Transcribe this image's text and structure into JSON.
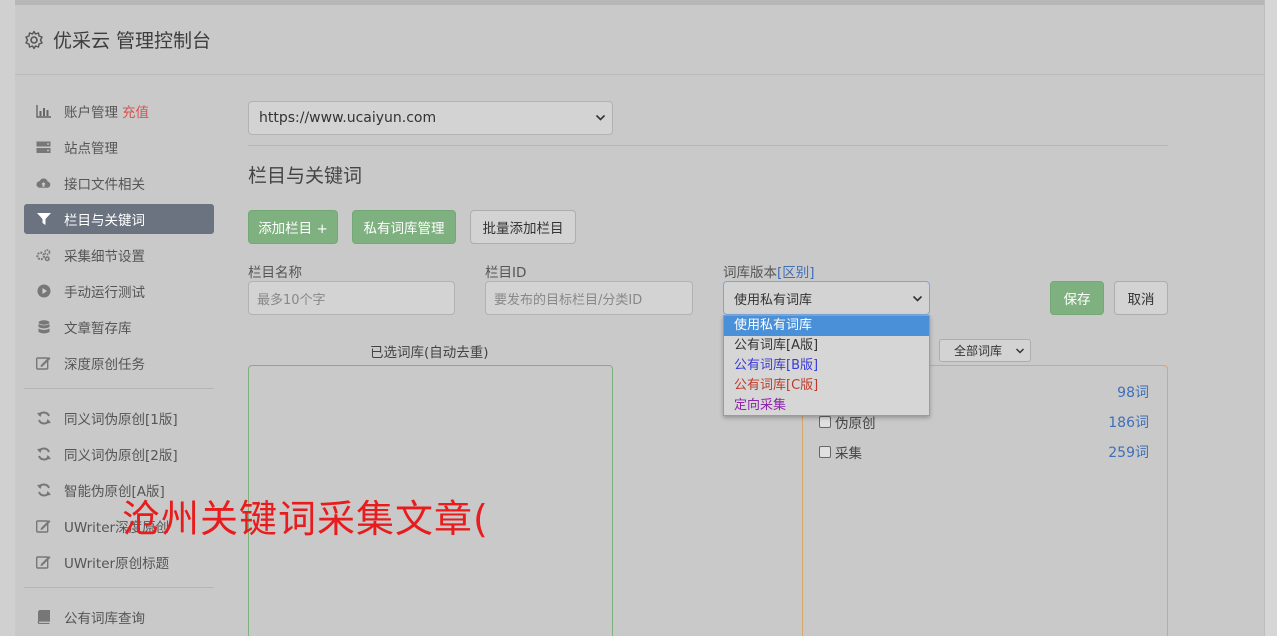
{
  "header": {
    "title": "优采云 管理控制台"
  },
  "sidebar": {
    "items": [
      {
        "label": "账户管理",
        "extra": "充值",
        "icon": "bar-chart-icon"
      },
      {
        "label": "站点管理",
        "icon": "server-icon"
      },
      {
        "label": "接口文件相关",
        "icon": "cloud-upload-icon"
      },
      {
        "label": "栏目与关键词",
        "icon": "filter-icon",
        "active": true
      },
      {
        "label": "采集细节设置",
        "icon": "cogs-icon"
      },
      {
        "label": "手动运行测试",
        "icon": "play-circle-icon"
      },
      {
        "label": "文章暂存库",
        "icon": "database-icon"
      },
      {
        "label": "深度原创任务",
        "icon": "edit-icon"
      }
    ],
    "items2": [
      {
        "label": "同义词伪原创[1版]",
        "icon": "refresh-icon"
      },
      {
        "label": "同义词伪原创[2版]",
        "icon": "refresh-icon"
      },
      {
        "label": "智能伪原创[A版]",
        "icon": "refresh-icon"
      },
      {
        "label": "UWriter深度原创",
        "icon": "edit-icon"
      },
      {
        "label": "UWriter原创标题",
        "icon": "edit-icon"
      }
    ],
    "items3": [
      {
        "label": "公有词库查询",
        "icon": "book-icon"
      }
    ]
  },
  "main": {
    "site_select": "https://www.ucaiyun.com",
    "section_title": "栏目与关键词",
    "buttons": {
      "add_column": "添加栏目 +",
      "private_lib": "私有词库管理",
      "batch_add": "批量添加栏目",
      "save": "保存",
      "cancel": "取消"
    },
    "form": {
      "column_name_label": "栏目名称",
      "column_name_placeholder": "最多10个字",
      "column_id_label": "栏目ID",
      "column_id_placeholder": "要发布的目标栏目/分类ID",
      "lib_version_label": "词库版本",
      "lib_version_link": "[区别]",
      "lib_version_value": "使用私有词库"
    },
    "dropdown": {
      "options": [
        {
          "label": "使用私有词库",
          "color": "#ffffff",
          "selected": true
        },
        {
          "label": "公有词库[A版]",
          "color": "#333333"
        },
        {
          "label": "公有词库[B版]",
          "color": "#3a3ad6"
        },
        {
          "label": "公有词库[C版]",
          "color": "#c0392b"
        },
        {
          "label": "定向采集",
          "color": "#8e24aa"
        }
      ]
    },
    "selected_libs_title": "已选词库(自动去重)",
    "lib_filter": "全部词库",
    "libs": [
      {
        "name": "",
        "count": "98词"
      },
      {
        "name": "伪原创",
        "count": "186词"
      },
      {
        "name": "采集",
        "count": "259词"
      }
    ]
  },
  "watermark": "沧州关键词采集文章("
}
